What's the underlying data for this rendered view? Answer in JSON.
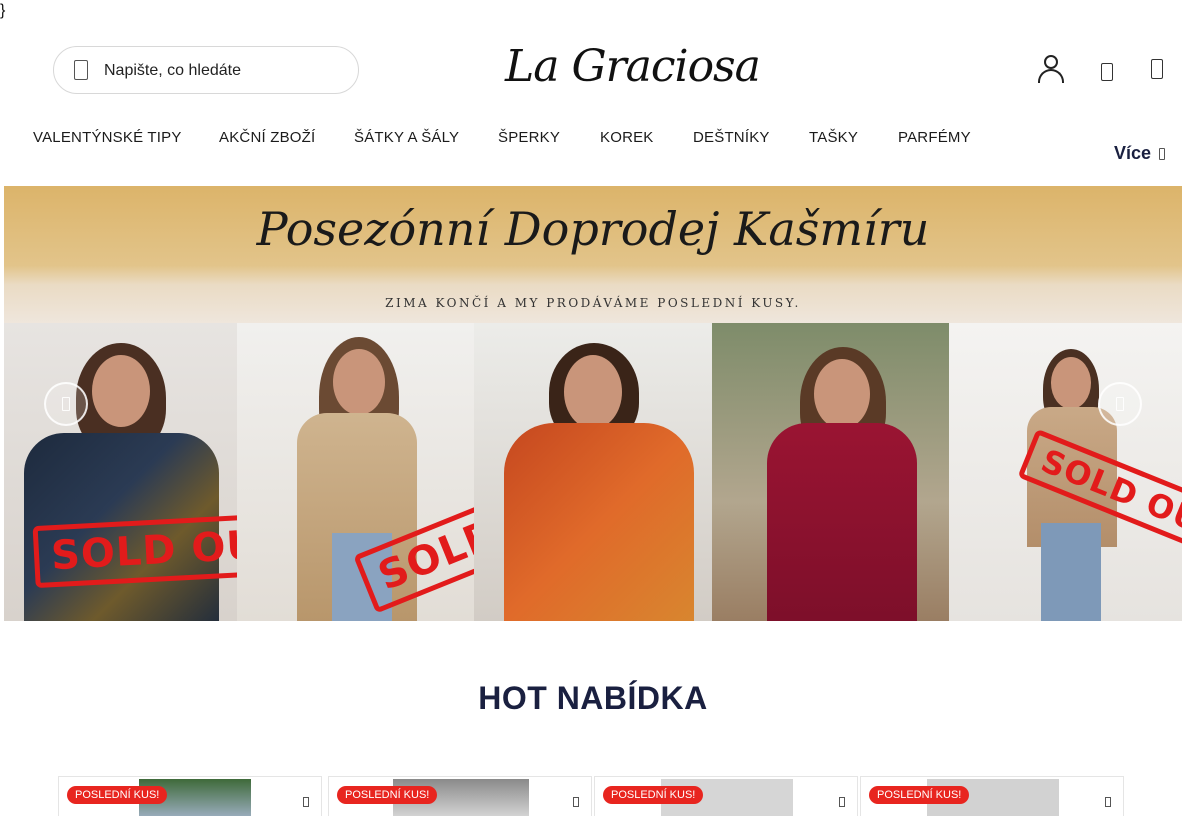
{
  "stray_text": "}",
  "header": {
    "search_placeholder": "Napište, co hledáte",
    "logo_text": "La Graciosa",
    "icons": [
      "search-icon",
      "user-icon",
      "heart-icon",
      "cart-icon"
    ]
  },
  "nav": {
    "items": [
      {
        "label": "VALENTÝNSKÉ TIPY"
      },
      {
        "label": "AKČNÍ ZBOŽÍ"
      },
      {
        "label": "ŠÁTKY A ŠÁLY"
      },
      {
        "label": "ŠPERKY"
      },
      {
        "label": "KOREK"
      },
      {
        "label": "DEŠTNÍKY"
      },
      {
        "label": "TAŠKY"
      },
      {
        "label": "PARFÉMY"
      }
    ],
    "more_label": "Více"
  },
  "banner": {
    "title": "Posezónní Doprodej Kašmíru",
    "subtitle": "ZIMA KONČÍ A MY PRODÁVÁME POSLEDNÍ KUSY.",
    "stamp": "SOLD OUT",
    "colors": {
      "top": "#dcb46a",
      "stamp": "#e21b1b"
    }
  },
  "section": {
    "title": "HOT NABÍDKA"
  },
  "products": [
    {
      "badge": "POSLEDNÍ KUS!"
    },
    {
      "badge": "POSLEDNÍ KUS!"
    },
    {
      "badge": "POSLEDNÍ KUS!"
    },
    {
      "badge": "POSLEDNÍ KUS!"
    }
  ]
}
